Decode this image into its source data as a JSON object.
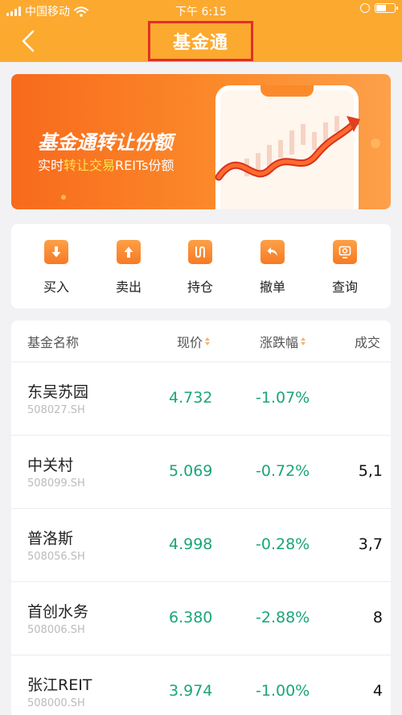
{
  "status_bar": {
    "carrier": "中国移动",
    "time": "下午 6:15"
  },
  "nav": {
    "title": "基金通"
  },
  "banner": {
    "title": "基金通转让份额",
    "subtitle_pre": "实时",
    "subtitle_hl": "转让交易",
    "subtitle_post": "REITs份额"
  },
  "menu": [
    {
      "label": "买入",
      "icon": "arrow-down-icon"
    },
    {
      "label": "卖出",
      "icon": "arrow-up-icon"
    },
    {
      "label": "持仓",
      "icon": "holdings-icon"
    },
    {
      "label": "撤单",
      "icon": "undo-icon"
    },
    {
      "label": "查询",
      "icon": "search-icon"
    }
  ],
  "table": {
    "headers": {
      "name": "基金名称",
      "price": "现价",
      "change": "涨跌幅",
      "volume": "成交"
    },
    "rows": [
      {
        "name": "东吴苏园",
        "code": "508027.SH",
        "price": "4.732",
        "change": "-1.07%",
        "volume": ""
      },
      {
        "name": "中关村",
        "code": "508099.SH",
        "price": "5.069",
        "change": "-0.72%",
        "volume": "5,1"
      },
      {
        "name": "普洛斯",
        "code": "508056.SH",
        "price": "4.998",
        "change": "-0.28%",
        "volume": "3,7"
      },
      {
        "name": "首创水务",
        "code": "508006.SH",
        "price": "6.380",
        "change": "-2.88%",
        "volume": "8"
      },
      {
        "name": "张江REIT",
        "code": "508000.SH",
        "price": "3.974",
        "change": "-1.00%",
        "volume": "4"
      }
    ]
  },
  "colors": {
    "header": "#fca92f",
    "accent": "#f77a25",
    "down_green": "#1aa57a",
    "highlight_box": "#e0302b"
  }
}
